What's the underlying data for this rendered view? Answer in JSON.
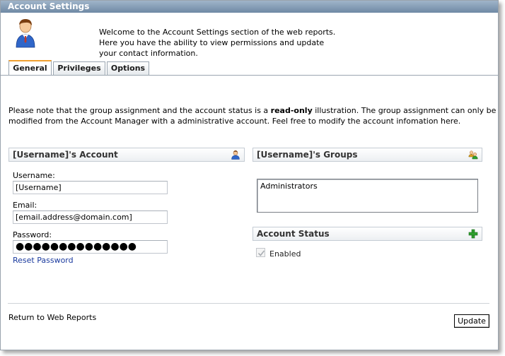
{
  "window": {
    "title": "Account Settings"
  },
  "intro": {
    "lines": [
      "Welcome to the Account Settings section of the web reports.",
      "Here you have the ability to view permissions and update",
      "your contact information."
    ]
  },
  "tabs": [
    {
      "label": "General",
      "active": true
    },
    {
      "label": "Privileges",
      "active": false
    },
    {
      "label": "Options",
      "active": false
    }
  ],
  "note": {
    "part1": "Please note that the group assignment and the account status is a ",
    "emphasis": "read-only",
    "part2": " illustration. The group assignment can only be modified from the Account Manager with a administrative account. Feel free to modify the account infomation here."
  },
  "account_section": {
    "title": "[Username]'s Account",
    "icon": "user-icon",
    "username_label": "Username:",
    "username_value": "[Username]",
    "email_label": "Email:",
    "email_value": "[email.address@domain.com]",
    "password_label": "Password:",
    "password_value": "●●●●●●●●●●●●●●",
    "reset_link": "Reset Password"
  },
  "groups_section": {
    "title": "[Username]'s Groups",
    "icon": "group-icon",
    "groups": [
      "Administrators"
    ]
  },
  "status_section": {
    "title": "Account Status",
    "icon": "add-icon",
    "enabled_label": "Enabled",
    "enabled_checked": true
  },
  "footer": {
    "return_link": "Return to Web Reports",
    "update_button": "Update"
  },
  "colors": {
    "title_bar": "#6f89a5",
    "tab_accent": "#f0a030",
    "link": "#1a3a9e",
    "add_icon": "#2fa02f"
  }
}
